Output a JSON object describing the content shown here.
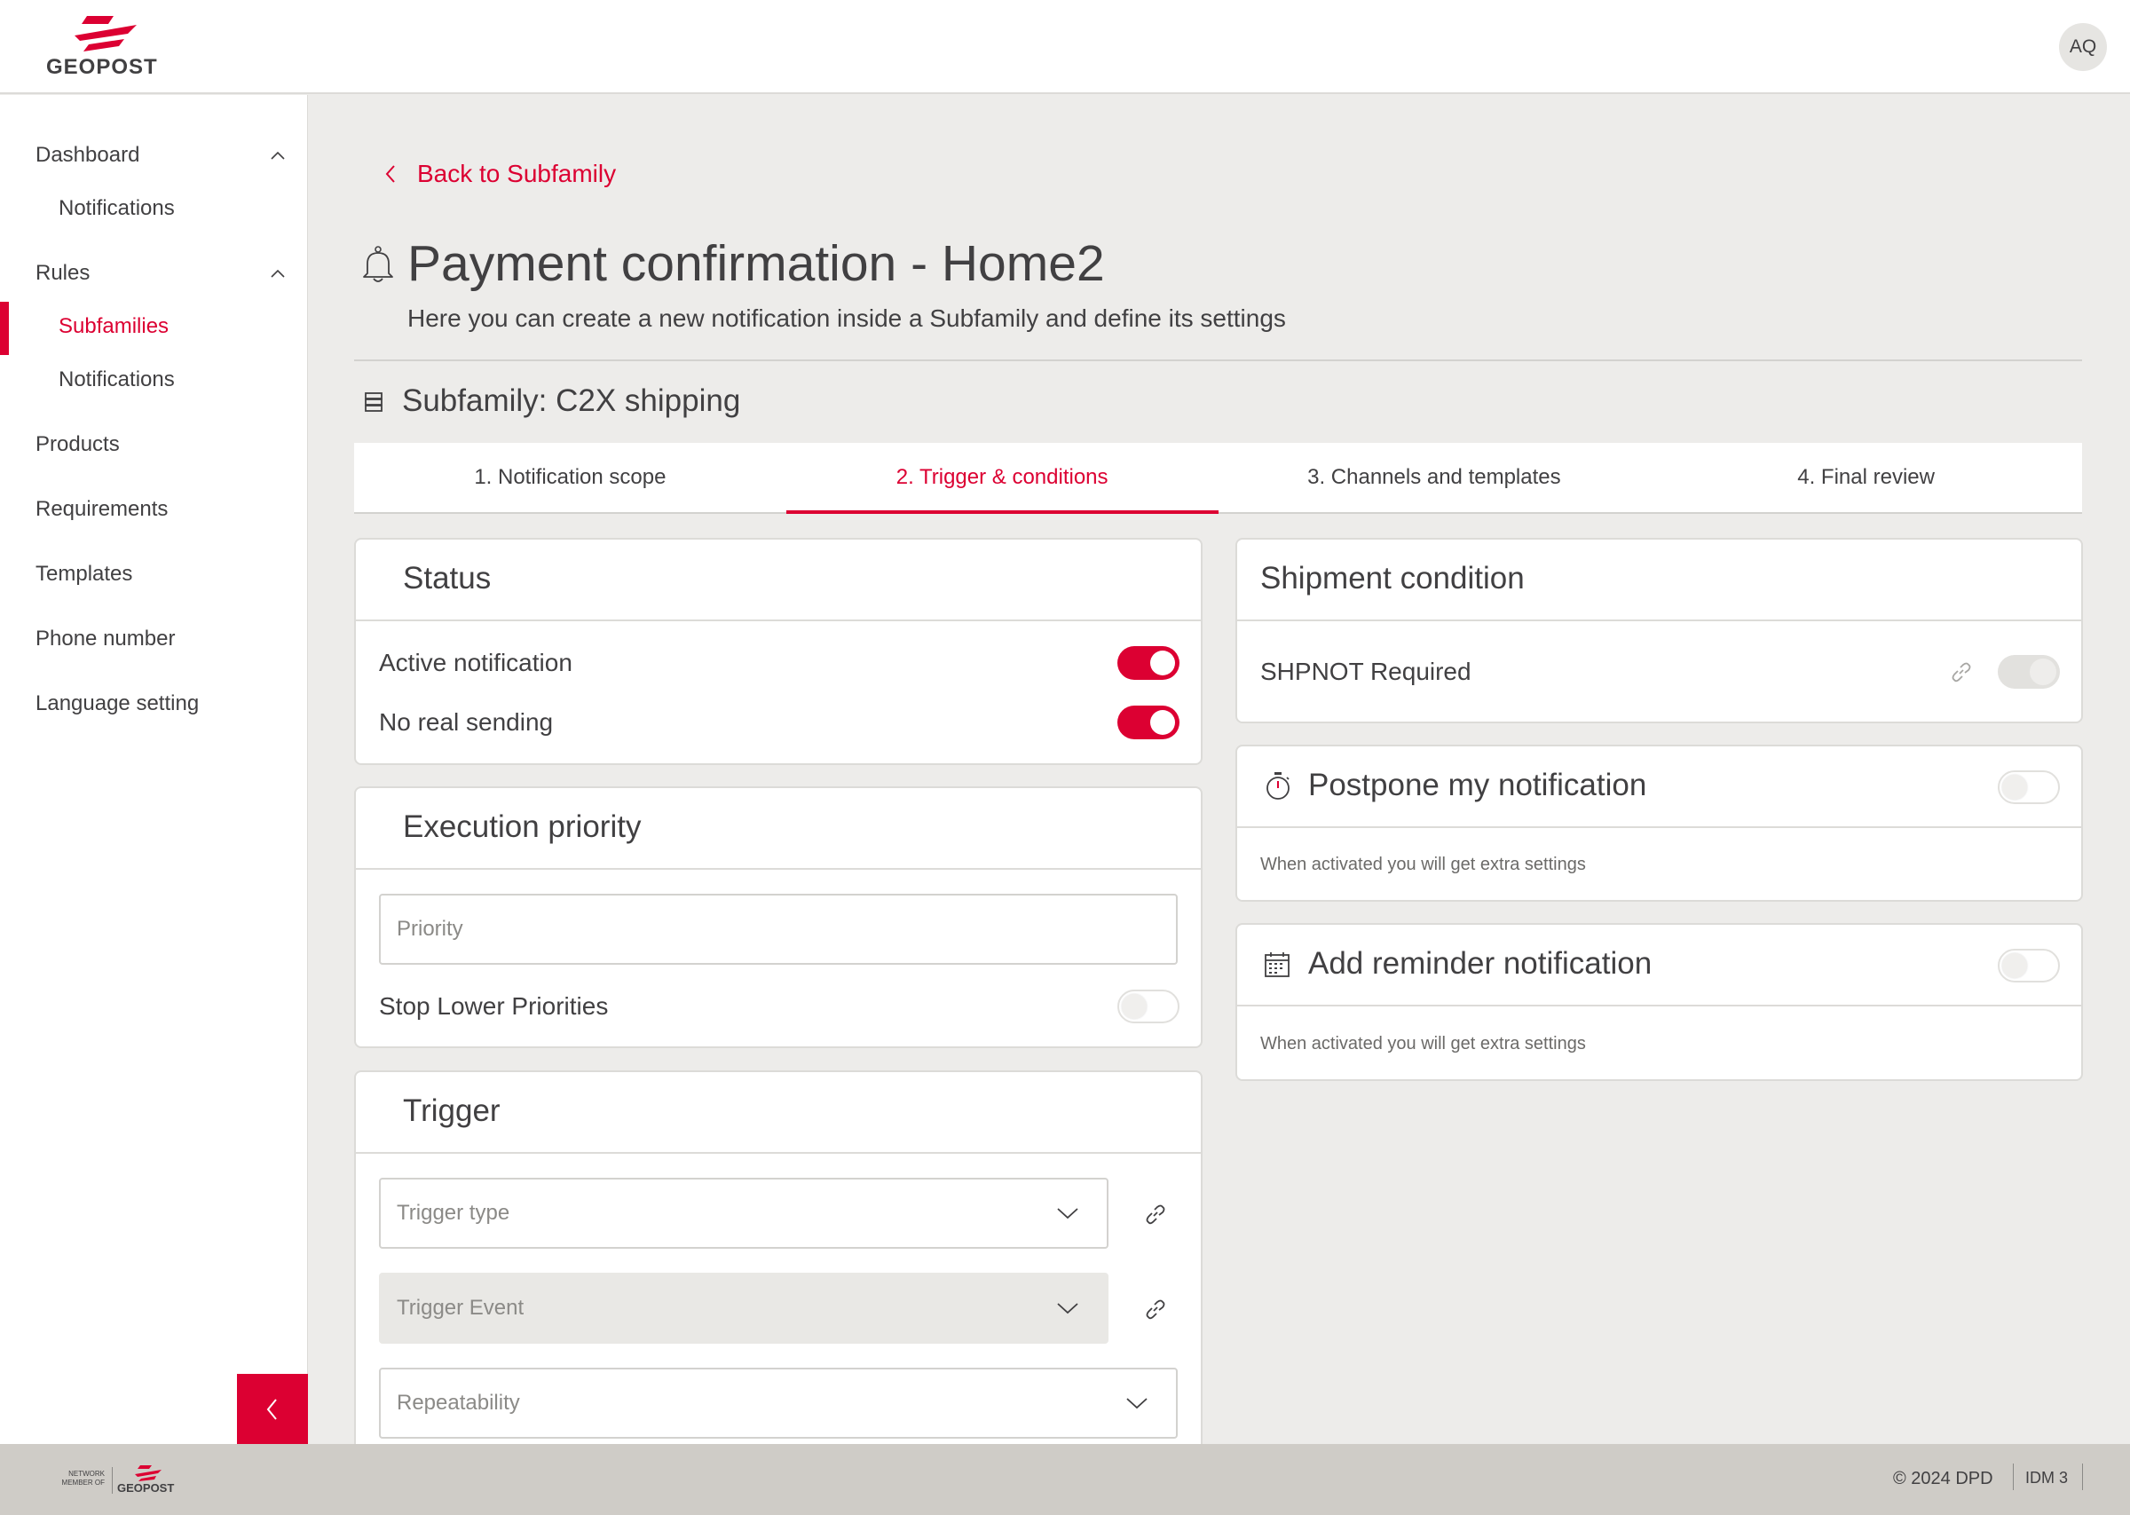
{
  "header": {
    "brand": "GEOPOST",
    "avatar_initials": "AQ"
  },
  "sidebar": {
    "dashboard": "Dashboard",
    "dashboard_notifications": "Notifications",
    "rules": "Rules",
    "rules_subfamilies": "Subfamilies",
    "rules_notifications": "Notifications",
    "products": "Products",
    "requirements": "Requirements",
    "templates": "Templates",
    "phone_number": "Phone number",
    "language_setting": "Language setting"
  },
  "page": {
    "back_label": "Back to Subfamily",
    "title": "Payment confirmation - Home2",
    "subtitle": "Here you can create a new notification inside a Subfamily and define its settings",
    "subfamily": "Subfamily: C2X shipping"
  },
  "tabs": [
    {
      "label": "1. Notification scope"
    },
    {
      "label": "2. Trigger & conditions"
    },
    {
      "label": "3. Channels and templates"
    },
    {
      "label": "4. Final review"
    }
  ],
  "status_card": {
    "title": "Status",
    "active_label": "Active notification",
    "active_on": true,
    "no_real_label": "No real sending",
    "no_real_on": true
  },
  "priority_card": {
    "title": "Execution priority",
    "priority_placeholder": "Priority",
    "stop_lower_label": "Stop Lower Priorities",
    "stop_lower_on": false
  },
  "trigger_card": {
    "title": "Trigger",
    "trigger_type_placeholder": "Trigger type",
    "trigger_event_placeholder": "Trigger Event",
    "repeatability_placeholder": "Repeatability"
  },
  "shipment_card": {
    "title": "Shipment condition",
    "condition_label": "SHPNOT  Required"
  },
  "postpone_card": {
    "title": "Postpone my notification",
    "hint": "When activated you will get extra settings"
  },
  "reminder_card": {
    "title": "Add reminder notification",
    "hint": "When activated you will get extra settings"
  },
  "footer": {
    "network_member": "NETWORK MEMBER OF",
    "brand": "GEOPOST",
    "copyright": "© 2024 DPD",
    "version": "IDM 3"
  },
  "colors": {
    "accent": "#dc0032",
    "text": "#414042",
    "background": "#edecea"
  }
}
